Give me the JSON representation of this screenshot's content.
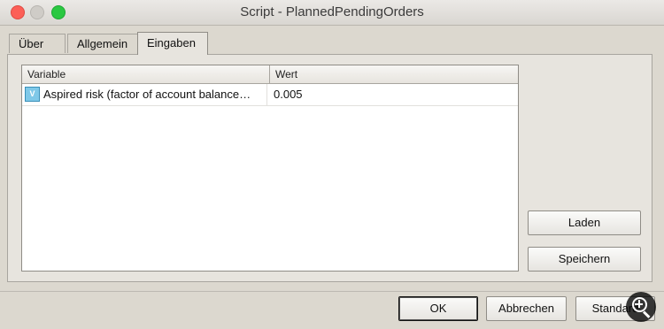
{
  "window": {
    "title": "Script - PlannedPendingOrders"
  },
  "tabs": [
    {
      "label": "Über",
      "active": false
    },
    {
      "label": "Allgemein",
      "active": false
    },
    {
      "label": "Eingaben",
      "active": true
    }
  ],
  "table": {
    "columns": [
      "Variable",
      "Wert"
    ],
    "rows": [
      {
        "icon": "parameter-icon",
        "variable": "Aspired risk (factor of account balance…",
        "value": "0.005"
      }
    ]
  },
  "side_buttons": {
    "laden": "Laden",
    "speichern": "Speichern"
  },
  "footer_buttons": {
    "ok": "OK",
    "abbrechen": "Abbrechen",
    "standard": "Standard"
  },
  "icons": {
    "row_icon": "V",
    "zoom": "zoom-in-icon"
  },
  "colors": {
    "close": "#fc5f57",
    "minimize": "#cfccc7",
    "maximize": "#2ac841"
  }
}
